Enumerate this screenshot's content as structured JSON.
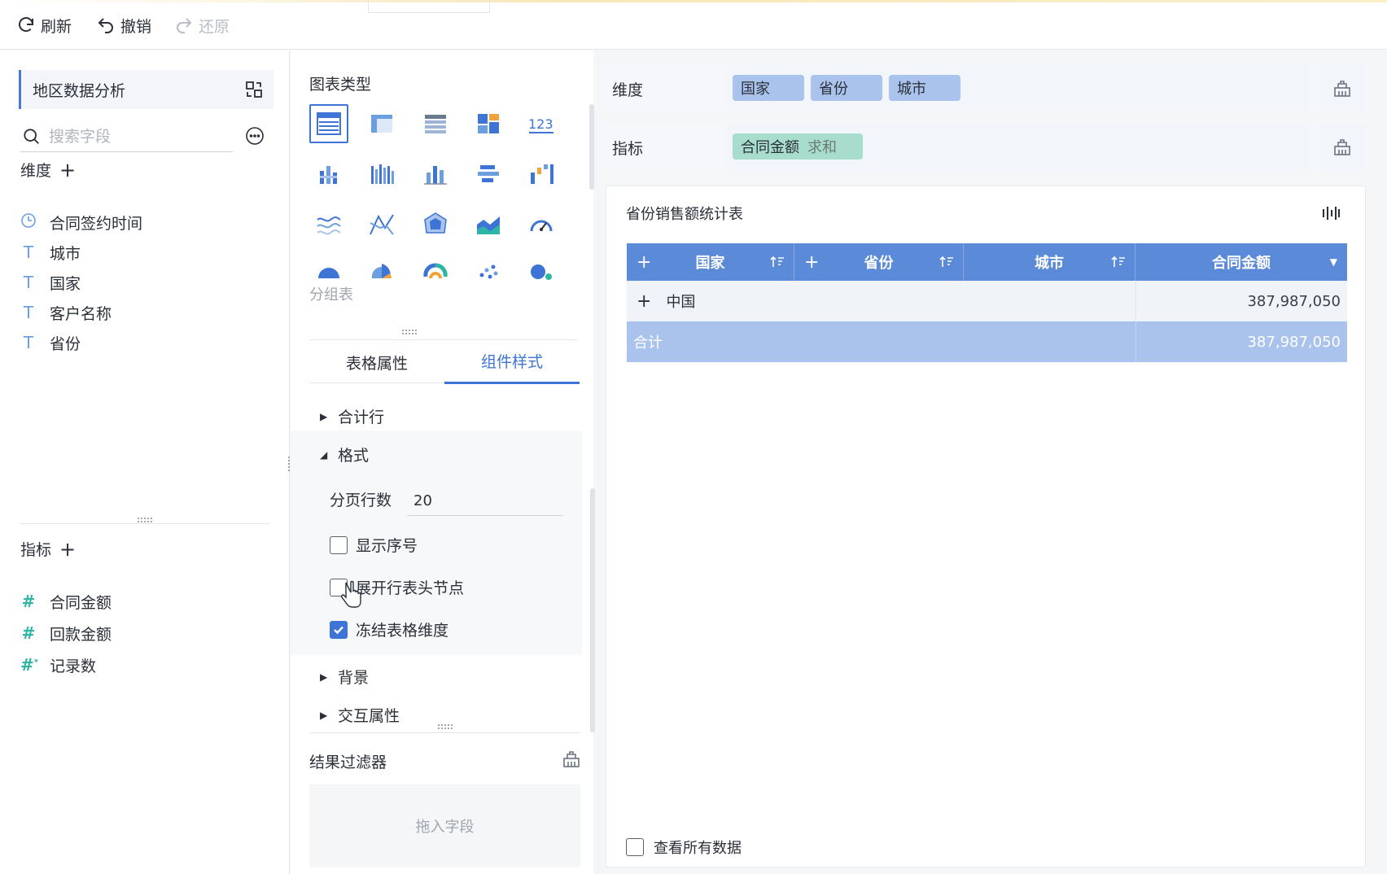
{
  "toolbar": {
    "refresh": "刷新",
    "undo": "撤销",
    "redo": "还原"
  },
  "left": {
    "dataset_name": "地区数据分析",
    "search_placeholder": "搜索字段",
    "dimensions_title": "维度",
    "dimensions": [
      {
        "icon": "clock-icon",
        "label": "合同签约时间"
      },
      {
        "icon": "text-type-icon",
        "label": "城市"
      },
      {
        "icon": "text-type-icon",
        "label": "国家"
      },
      {
        "icon": "text-type-icon",
        "label": "客户名称"
      },
      {
        "icon": "text-type-icon",
        "label": "省份"
      }
    ],
    "measures_title": "指标",
    "measures": [
      {
        "icon": "number-type-icon",
        "label": "合同金额"
      },
      {
        "icon": "number-type-icon",
        "label": "回款金额"
      },
      {
        "icon": "number-type-icon",
        "label": "记录数"
      }
    ]
  },
  "middle": {
    "chart_type_title": "图表类型",
    "selected_chart_label": "分组表",
    "tabs": [
      "表格属性",
      "组件样式"
    ],
    "active_tab": "组件样式",
    "sections": {
      "total_row": "合计行",
      "format": "格式",
      "page_rows_label": "分页行数",
      "page_rows_value": "20",
      "show_serial": "显示序号",
      "expand_header_nodes": "展开行表头节点",
      "freeze_dims": "冻结表格维度",
      "background": "背景",
      "interaction": "交互属性"
    },
    "checkbox_states": {
      "show_serial": false,
      "expand_header_nodes": false,
      "freeze_dims": true
    },
    "result_filter_title": "结果过滤器",
    "drop_hint": "拖入字段"
  },
  "right": {
    "dimension_shelf_label": "维度",
    "dimension_pills": [
      "国家",
      "省份",
      "城市"
    ],
    "measure_shelf_label": "指标",
    "measure_pill": "合同金额",
    "measure_pill_agg": "求和",
    "table_title": "省份销售额统计表",
    "table": {
      "columns": [
        "国家",
        "省份",
        "城市",
        "合同金额"
      ],
      "rows": [
        {
          "country": "中国",
          "amount": "387,987,050"
        }
      ],
      "total_label": "合计",
      "total_amount": "387,987,050"
    },
    "view_all_data": "查看所有数据"
  },
  "colors": {
    "accent": "#3d74d6",
    "header_blue": "#5b8ad8",
    "total_row": "#a9c3ec",
    "dim_pill": "#a9c3ec",
    "measure_pill": "#a8dccd"
  }
}
